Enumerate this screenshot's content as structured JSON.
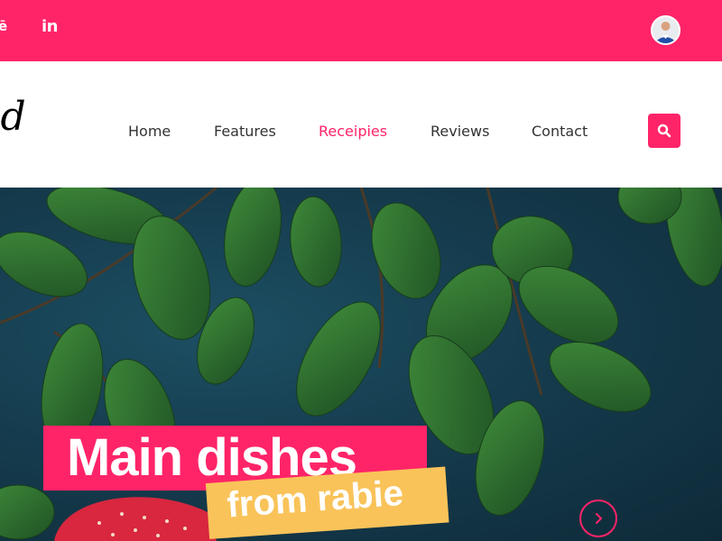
{
  "topbar": {
    "partial_icon_glyph": "ē",
    "linkedin_label": "in"
  },
  "header": {
    "logo_text": "od"
  },
  "nav": {
    "items": [
      {
        "label": "Home"
      },
      {
        "label": "Features"
      },
      {
        "label": "Receipies",
        "active": true
      },
      {
        "label": "Reviews"
      },
      {
        "label": "Contact"
      }
    ]
  },
  "hero": {
    "title": "Main dishes",
    "subtitle": "from rabie"
  },
  "colors": {
    "accent": "#ff2468",
    "secondary": "#f9c35a",
    "hero_bg": "#153c4e",
    "leaf": "#2d6a2f"
  },
  "icons": {
    "search": "search-icon",
    "next": "chevron-right-icon",
    "avatar": "avatar"
  }
}
